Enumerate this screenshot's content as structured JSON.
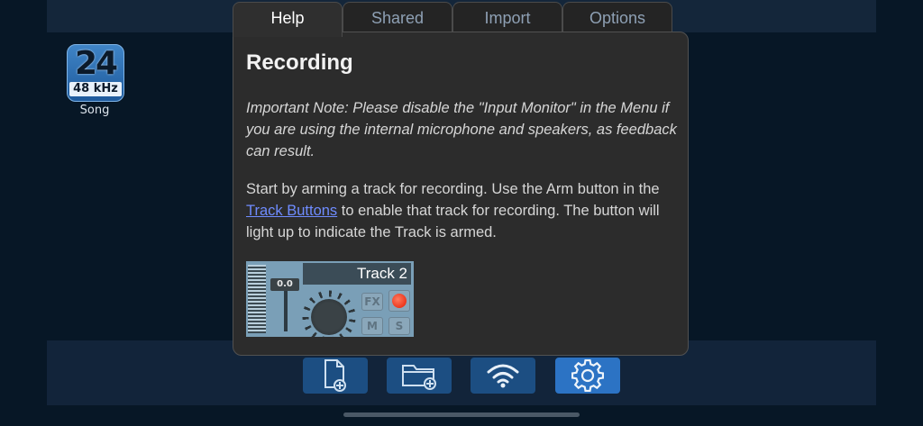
{
  "song": {
    "bits": "24",
    "rate": "48 kHz",
    "label": "Song"
  },
  "tabs": [
    {
      "label": "Help",
      "active": true
    },
    {
      "label": "Shared",
      "active": false
    },
    {
      "label": "Import",
      "active": false
    },
    {
      "label": "Options",
      "active": false
    }
  ],
  "help": {
    "title": "Recording",
    "note": "Important Note: Please disable the \"Input Monitor\" in the Menu if you are using the internal microphone and speakers, as feedback can result.",
    "para_before": "Start by arming a track for recording. Use the Arm button in the ",
    "link": "Track Buttons",
    "para_after": " to enable that track for recording. The button will light up to indicate the Track is armed."
  },
  "track_image": {
    "name": "Track 2",
    "fader": "0.0",
    "fx": "FX",
    "mute": "M",
    "solo": "S"
  },
  "dock": [
    {
      "icon": "new-file-icon"
    },
    {
      "icon": "new-folder-icon"
    },
    {
      "icon": "wifi-icon"
    },
    {
      "icon": "gear-icon",
      "active": true
    }
  ],
  "colors": {
    "accent": "#2c73c4",
    "link": "#6f8cff",
    "arm": "#e41a00"
  }
}
